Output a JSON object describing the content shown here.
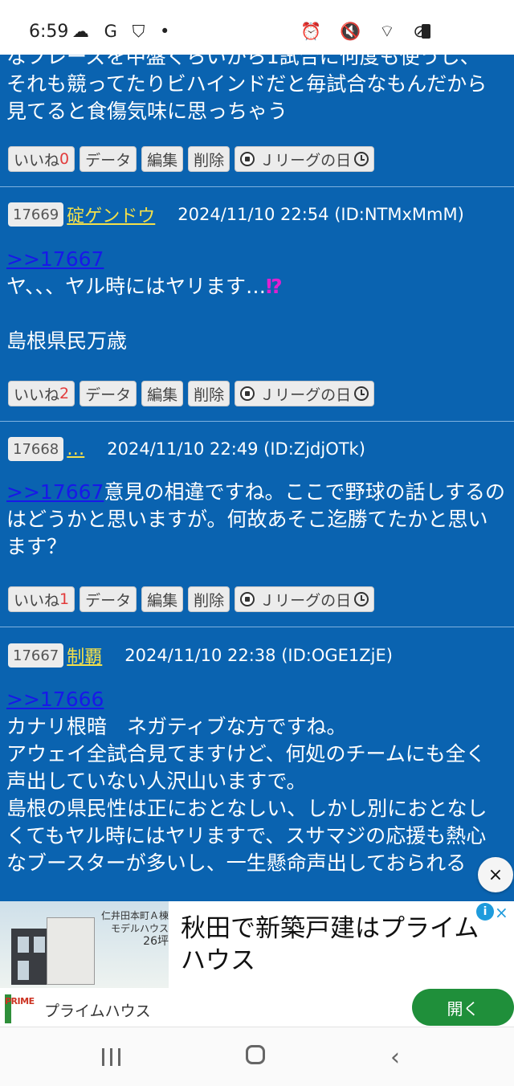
{
  "status": {
    "time": "6:59",
    "left_icons": "☁ G ⛉ •",
    "right_icons": "⏰ 🔇 ⌔ ⊘"
  },
  "posts": [
    {
      "id": "prev",
      "lines": [
        "なフレーズを中盤くらいから1試合に何度も使うし、",
        "それも競ってたりビハインドだと毎試合なもんだから",
        "見てると食傷気味に思っちゃう"
      ],
      "like_label": "いいね",
      "like_count": "0"
    },
    {
      "id": "17669",
      "number": "17669",
      "author": "碇ゲンドウ",
      "meta": "2024/11/10 22:54 (ID:NTMxMmM)",
      "reply": ">>17667",
      "line1": "ヤ、、、ヤル時にはヤリます…",
      "alert": "⁉",
      "line2": "島根県民万歳",
      "like_label": "いいね",
      "like_count": "2"
    },
    {
      "id": "17668",
      "number": "17668",
      "author": "…",
      "meta": "2024/11/10 22:49 (ID:ZjdjOTk)",
      "reply": ">>17667",
      "line1": "意見の相違ですね。ここで野球の話しするの",
      "line2": "はどうかと思いますが。何故あそこ迄勝てたかと思い",
      "line3": "ます？",
      "like_label": "いいね",
      "like_count": "1"
    },
    {
      "id": "17667",
      "number": "17667",
      "author": "制覇",
      "meta": "2024/11/10 22:38 (ID:OGE1ZjE)",
      "reply": ">>17666",
      "lines": [
        "カナリ根暗　ネガティブな方ですね。",
        "アウェイ全試合見てますけど、何処のチームにも全く",
        "声出していない人沢山いますで。",
        "島根の県民性は正におとなしい、しかし別におとなし",
        "くてもヤル時にはヤリますで、スサマジの応援も熱心",
        "なブースターが多いし、一生懸命声出しておられる"
      ]
    }
  ],
  "buttons": {
    "data": "データ",
    "edit": "編集",
    "delete": "削除",
    "jleague": "Ｊリーグの日"
  },
  "close_fab": "×",
  "ad": {
    "image_caption_1": "仁井田本町Ａ棟",
    "image_caption_2": "モデルハウス",
    "image_caption_3": "26坪",
    "headline": "秋田で新築戸建はプライムハウス",
    "logo_text": "PRIME",
    "brand": "プライムハウス",
    "open_label": "開く",
    "info": "i",
    "close": "×"
  }
}
